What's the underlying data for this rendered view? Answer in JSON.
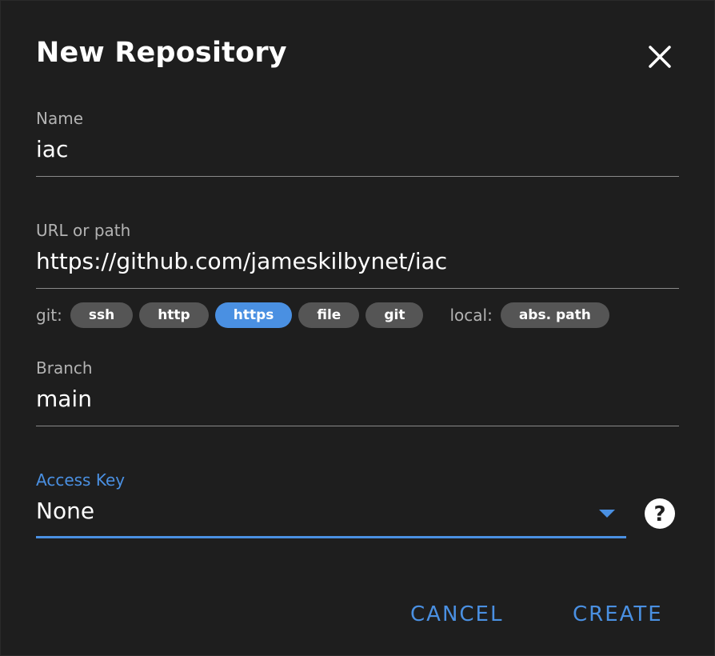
{
  "dialog": {
    "title": "New Repository"
  },
  "fields": {
    "name": {
      "label": "Name",
      "value": "iac"
    },
    "url": {
      "label": "URL or path",
      "value": "https://github.com/jameskilbynet/iac"
    },
    "branch": {
      "label": "Branch",
      "value": "main"
    },
    "access_key": {
      "label": "Access Key",
      "value": "None"
    }
  },
  "url_chips": {
    "git_prefix": "git:",
    "git_items": [
      "ssh",
      "http",
      "https",
      "file",
      "git"
    ],
    "active": "https",
    "local_prefix": "local:",
    "local_items": [
      "abs. path"
    ]
  },
  "actions": {
    "cancel": "CANCEL",
    "create": "CREATE"
  },
  "icons": {
    "close": "close-icon",
    "help": "help-icon",
    "dropdown": "chevron-down-icon"
  },
  "colors": {
    "background": "#1e1e1e",
    "accent": "#4a90e2",
    "chip": "#555555",
    "label": "#b3b3b3"
  }
}
